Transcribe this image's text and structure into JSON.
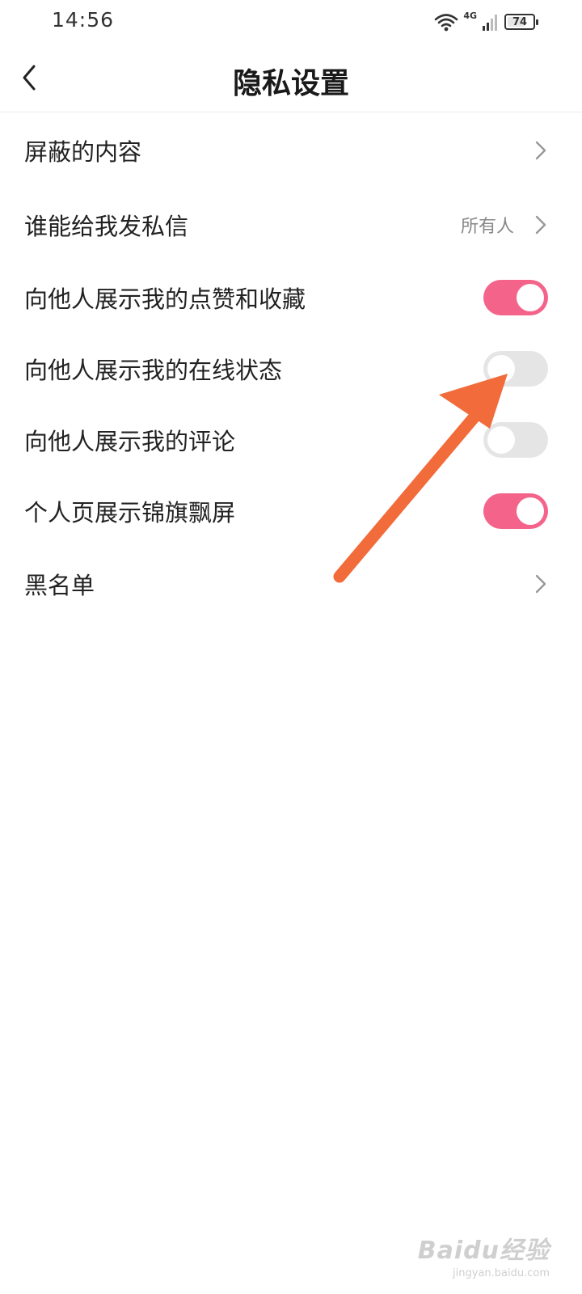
{
  "status_bar": {
    "time": "14:56",
    "network": "4G",
    "battery": "74",
    "battery_level": 0.74
  },
  "header": {
    "title": "隐私设置",
    "back_icon": "chevron-left-icon"
  },
  "settings": [
    {
      "label": "屏蔽的内容",
      "type": "link"
    },
    {
      "label": "谁能给我发私信",
      "type": "link",
      "value": "所有人"
    },
    {
      "label": "向他人展示我的点赞和收藏",
      "type": "toggle",
      "on": true
    },
    {
      "label": "向他人展示我的在线状态",
      "type": "toggle",
      "on": false
    },
    {
      "label": "向他人展示我的评论",
      "type": "toggle",
      "on": false
    },
    {
      "label": "个人页展示锦旗飘屏",
      "type": "toggle",
      "on": true
    },
    {
      "label": "黑名单",
      "type": "link"
    }
  ],
  "colors": {
    "toggle_on": "#f4648a",
    "toggle_off": "#e5e5e5",
    "annotation_arrow": "#f26b3a"
  },
  "watermark": {
    "logo": "Baidu经验",
    "url": "jingyan.baidu.com"
  }
}
